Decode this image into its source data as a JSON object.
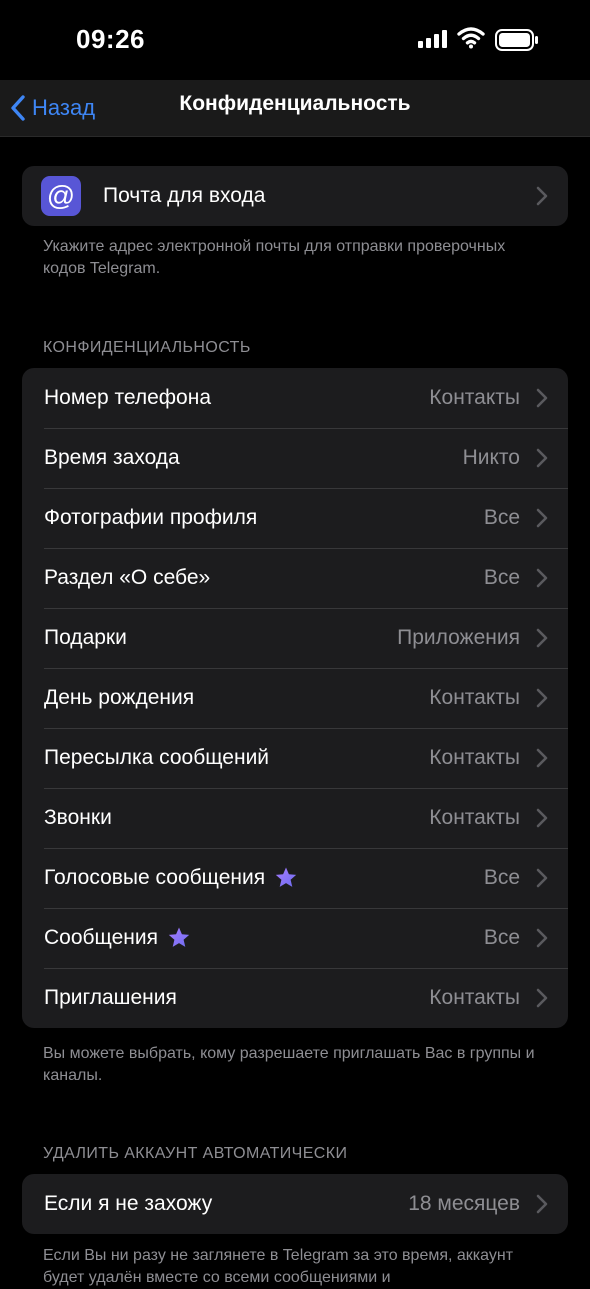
{
  "status": {
    "time": "09:26"
  },
  "nav": {
    "back_label": "Назад",
    "title": "Конфиденциальность"
  },
  "login_email": {
    "icon": "at-sign-icon",
    "icon_color": "#5856d6",
    "label": "Почта для входа",
    "footnote": "Укажите адрес электронной почты для отправки проверочных кодов Telegram."
  },
  "privacy": {
    "header": "КОНФИДЕНЦИАЛЬНОСТЬ",
    "items": [
      {
        "label": "Номер телефона",
        "value": "Контакты"
      },
      {
        "label": "Время захода",
        "value": "Никто"
      },
      {
        "label": "Фотографии профиля",
        "value": "Все"
      },
      {
        "label": "Раздел «О себе»",
        "value": "Все"
      },
      {
        "label": "Подарки",
        "value": "Приложения"
      },
      {
        "label": "День рождения",
        "value": "Контакты"
      },
      {
        "label": "Пересылка сообщений",
        "value": "Контакты"
      },
      {
        "label": "Звонки",
        "value": "Контакты"
      },
      {
        "label": "Голосовые сообщения",
        "value": "Все",
        "premium": true
      },
      {
        "label": "Сообщения",
        "value": "Все",
        "premium": true
      },
      {
        "label": "Приглашения",
        "value": "Контакты"
      }
    ],
    "footnote": "Вы можете выбрать, кому разрешаете приглашать Вас в группы и каналы."
  },
  "delete_account": {
    "header": "УДАЛИТЬ АККАУНТ АВТОМАТИЧЕСКИ",
    "label": "Если я не захожу",
    "value": "18 месяцев",
    "footnote": "Если Вы ни разу не заглянете в Telegram за это время, аккаунт будет удалён вместе со всеми сообщениями и"
  },
  "colors": {
    "accent": "#3e86f5",
    "premium_star": "#8e6df5",
    "background": "#000000",
    "card": "#1c1c1e"
  }
}
